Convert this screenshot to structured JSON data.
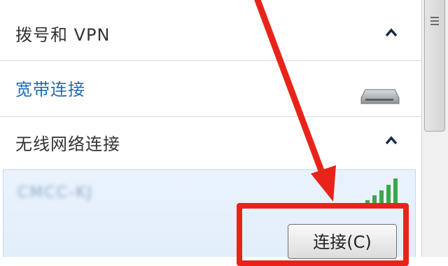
{
  "sections": {
    "dialup_vpn": {
      "title": "拨号和 VPN",
      "chevron": "chevron-up-icon"
    },
    "broadband": {
      "label": "宽带连接",
      "icon": "network-drive-icon"
    },
    "wireless": {
      "title": "无线网络连接",
      "chevron": "chevron-up-icon"
    }
  },
  "wifi": {
    "ssid": "CMCC-KJ",
    "signal_icon": "wifi-signal-icon",
    "connect_label": "连接(C)"
  },
  "colors": {
    "accent_link": "#1f6bb3",
    "annotation_red": "#e8241a",
    "selection_bg": "#e6f0fb"
  }
}
